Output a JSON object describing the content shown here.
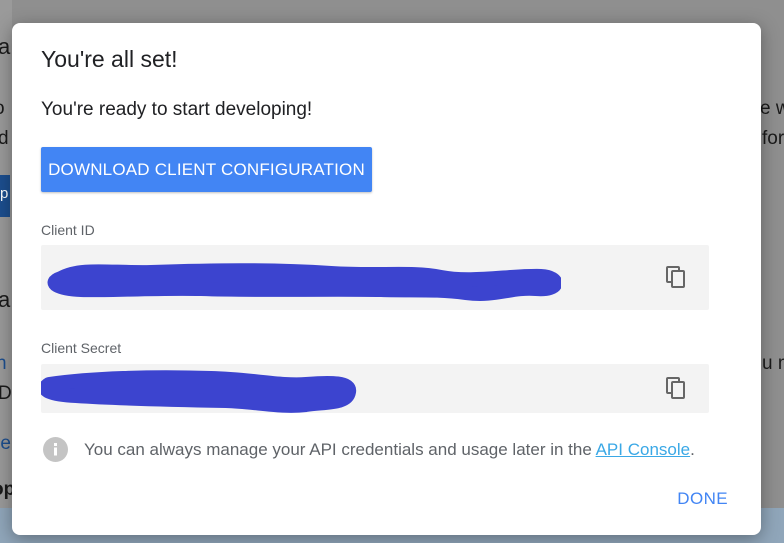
{
  "background": {
    "fragments": [
      "a",
      "o",
      "d",
      "p",
      "a",
      "n",
      "D",
      "re",
      "op",
      "e w",
      "for",
      "u m"
    ]
  },
  "dialog": {
    "title": "You're all set!",
    "subtitle": "You're ready to start developing!",
    "download_button": "DOWNLOAD CLIENT CONFIGURATION",
    "client_id": {
      "label": "Client ID",
      "value": "",
      "redacted": true
    },
    "client_secret": {
      "label": "Client Secret",
      "value": "",
      "redacted": true
    },
    "info": {
      "text": "You can always manage your API credentials and usage later in the ",
      "link_text": "API Console",
      "text_after": "."
    },
    "done_button": "DONE"
  },
  "colors": {
    "primary": "#4285f4",
    "link": "#3aa8e6",
    "redaction": "#3c44cf",
    "field_bg": "#f3f3f3",
    "overlay": "#8f8f8f"
  },
  "icons": {
    "copy": "copy-icon",
    "info": "info-icon"
  }
}
